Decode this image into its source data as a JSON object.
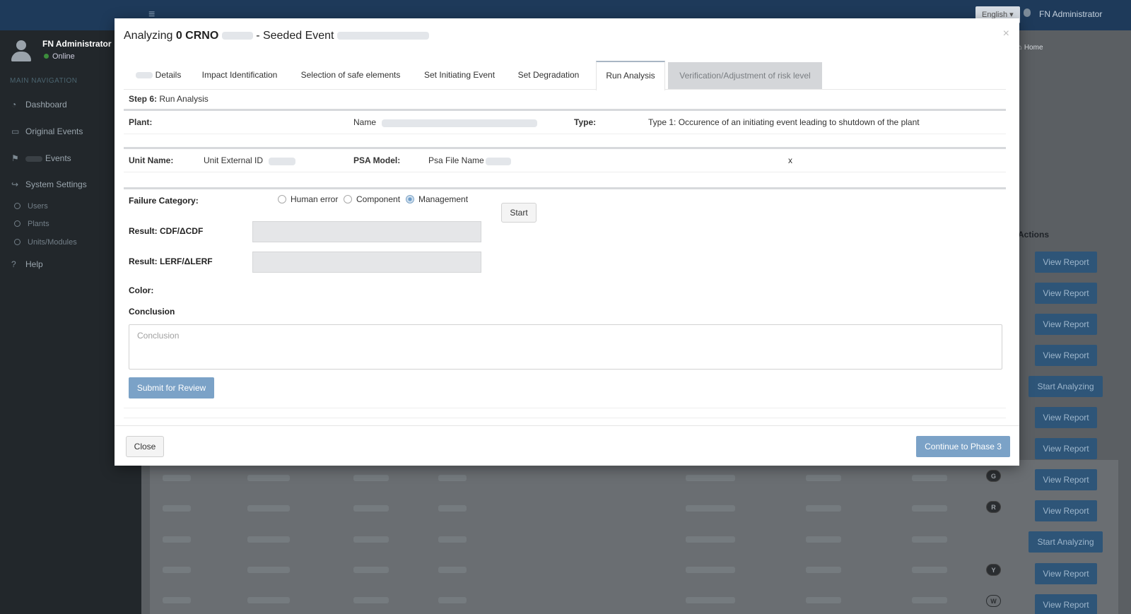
{
  "topbar": {
    "language": "English ▾",
    "user": "FN Administrator"
  },
  "sidebar": {
    "user_name": "FN Administrator",
    "status": "Online",
    "nav_header": "MAIN NAVIGATION",
    "items": [
      {
        "label": "Dashboard",
        "icon": "dashboard-icon"
      },
      {
        "label": "Original Events",
        "icon": "inbox-icon"
      },
      {
        "label": "Events",
        "icon": "flag-icon"
      },
      {
        "label": "System Settings",
        "icon": "share-icon"
      }
    ],
    "sub_items": [
      {
        "label": "Users"
      },
      {
        "label": "Plants"
      },
      {
        "label": "Units/Modules"
      }
    ],
    "help": "Help"
  },
  "content": {
    "breadcrumb": "Home",
    "actions_header": "Actions",
    "row_buttons": [
      {
        "label": "View Report"
      },
      {
        "label": "View Report"
      },
      {
        "label": "View Report"
      },
      {
        "label": "View Report"
      },
      {
        "label": "Start Analyzing"
      },
      {
        "label": "View Report"
      },
      {
        "label": "View Report"
      },
      {
        "label": "View Report"
      },
      {
        "label": "View Report"
      },
      {
        "label": "Start Analyzing"
      },
      {
        "label": "View Report"
      },
      {
        "label": "View Report"
      }
    ],
    "badges": [
      {
        "label": "G"
      },
      {
        "label": "R"
      },
      {
        "label": "Y"
      },
      {
        "label": "W"
      }
    ]
  },
  "modal": {
    "title_prefix": "Analyzing",
    "title_id": "0 CRNO",
    "title_mid": "- Seeded Event",
    "close_symbol": "×",
    "tabs": [
      {
        "label": "Details"
      },
      {
        "label": "Impact Identification"
      },
      {
        "label": "Selection of safe elements"
      },
      {
        "label": "Set Initiating Event"
      },
      {
        "label": "Set Degradation"
      },
      {
        "label": "Run Analysis"
      },
      {
        "label": "Verification/Adjustment of risk level"
      }
    ],
    "step_label": "Step 6:",
    "step_name": "Run Analysis",
    "info1": {
      "plant_label": "Plant:",
      "name_label": "Name",
      "type_label": "Type:",
      "type_value": "Type 1: Occurence of an initiating event leading to shutdown of the plant"
    },
    "info2": {
      "unit_label": "Unit Name:",
      "unit_ext": "Unit External ID",
      "psa_label": "PSA Model:",
      "psa_file": "Psa File Name",
      "x_mark": "x"
    },
    "form": {
      "failure_label": "Failure Category:",
      "options": [
        {
          "label": "Human error",
          "checked": false
        },
        {
          "label": "Component",
          "checked": false
        },
        {
          "label": "Management",
          "checked": true
        }
      ],
      "start_button": "Start",
      "cdf_label": "Result: CDF/ΔCDF",
      "lerf_label": "Result: LERF/ΔLERF",
      "color_label": "Color:",
      "conclusion_label": "Conclusion",
      "conclusion_placeholder": "Conclusion",
      "submit_button": "Submit for Review"
    },
    "footer": {
      "close_button": "Close",
      "continue_button": "Continue to Phase 3"
    }
  },
  "colors": {
    "primary_button": "#7ba2c7",
    "topbar": "#1e3a5a",
    "sidebar": "#22272b"
  }
}
